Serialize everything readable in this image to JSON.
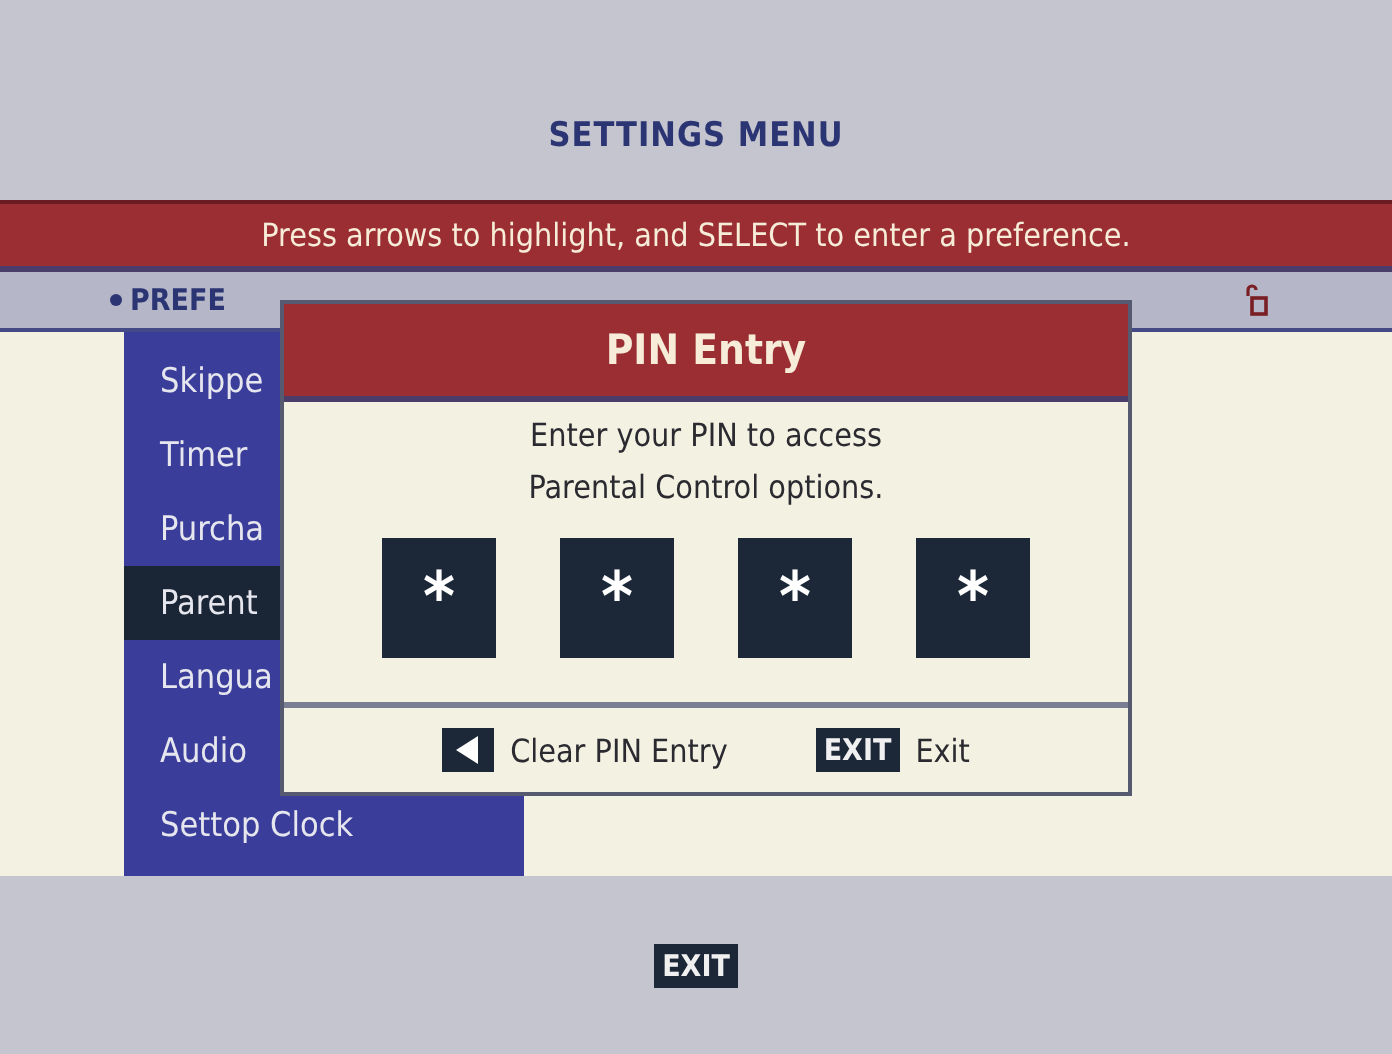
{
  "title": "SETTINGS MENU",
  "instruction": "Press arrows to highlight, and SELECT to enter a preference.",
  "section": {
    "label": "PREFE"
  },
  "menu": [
    {
      "label": "Skippe",
      "selected": false
    },
    {
      "label": "Timer",
      "selected": false
    },
    {
      "label": "Purcha",
      "selected": false
    },
    {
      "label": "Parent",
      "selected": true
    },
    {
      "label": "Langua",
      "selected": false
    },
    {
      "label": "Audio",
      "selected": false
    },
    {
      "label": "Settop Clock",
      "selected": false
    }
  ],
  "dialog": {
    "title": "PIN Entry",
    "message": "Enter your PIN to access Parental Control options.",
    "pin": [
      "*",
      "*",
      "*",
      "*"
    ],
    "hints": [
      {
        "kind": "arrow",
        "label": "Clear PIN Entry"
      },
      {
        "kind": "key",
        "key": "EXIT",
        "label": "Exit"
      }
    ]
  },
  "footer_key": "EXIT"
}
